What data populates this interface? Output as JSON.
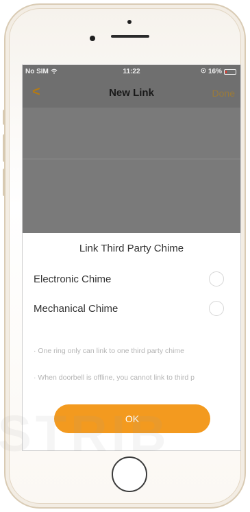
{
  "status_bar": {
    "carrier": "No SIM",
    "wifi_icon": "wifi-icon",
    "time": "11:22",
    "location_icon": "location-icon",
    "battery_percent": "16%",
    "battery_level": 0.16,
    "battery_color": "#e23a2f"
  },
  "nav": {
    "back_icon": "chevron-left-icon",
    "back_glyph": "<",
    "title": "New Link",
    "done_label": "Done"
  },
  "sheet": {
    "title": "Link Third Party Chime",
    "options": [
      {
        "label": "Electronic Chime",
        "selected": false
      },
      {
        "label": "Mechanical Chime",
        "selected": false
      }
    ],
    "notes": [
      "· One ring only can link to one third party chime",
      "· When doorbell is offline, you cannot link to third p"
    ],
    "ok_label": "OK"
  },
  "watermark": "ISTRIB",
  "colors": {
    "accent": "#f39a1f",
    "nav_back": "#b47a14",
    "overlay": "#7a7a7a"
  }
}
